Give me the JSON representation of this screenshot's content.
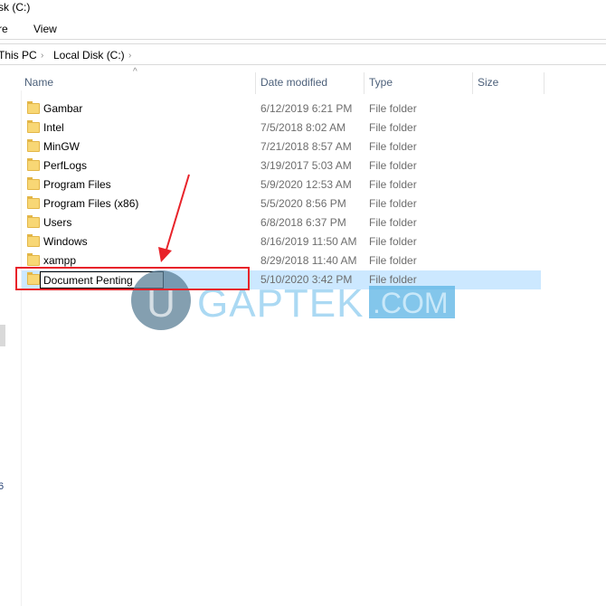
{
  "window": {
    "title": "sk (C:)"
  },
  "ribbon": {
    "tabs": [
      "re",
      "View"
    ]
  },
  "breadcrumb": [
    "This PC",
    "Local Disk (C:)"
  ],
  "columns": [
    "Name",
    "Date modified",
    "Type",
    "Size"
  ],
  "files": [
    {
      "name": "Gambar",
      "date": "6/12/2019 6:21 PM",
      "type": "File folder"
    },
    {
      "name": "Intel",
      "date": "7/5/2018 8:02 AM",
      "type": "File folder"
    },
    {
      "name": "MinGW",
      "date": "7/21/2018 8:57 AM",
      "type": "File folder"
    },
    {
      "name": "PerfLogs",
      "date": "3/19/2017 5:03 AM",
      "type": "File folder"
    },
    {
      "name": "Program Files",
      "date": "5/9/2020 12:53 AM",
      "type": "File folder"
    },
    {
      "name": "Program Files (x86)",
      "date": "5/5/2020 8:56 PM",
      "type": "File folder"
    },
    {
      "name": "Users",
      "date": "6/8/2018 6:37 PM",
      "type": "File folder"
    },
    {
      "name": "Windows",
      "date": "8/16/2019 11:50 AM",
      "type": "File folder"
    },
    {
      "name": "xampp",
      "date": "8/29/2018 11:40 AM",
      "type": "File folder"
    },
    {
      "name": "Document Penting",
      "date": "5/10/2020 3:42 PM",
      "type": "File folder"
    }
  ],
  "leftpane": {
    "fragment": "6"
  },
  "watermark": {
    "letter": "U",
    "brand": "GAPTEK",
    ".com": ".COM"
  },
  "colors": {
    "selection": "#cce8ff",
    "annotation": "#e8232a",
    "watermark": "#5ab4e5"
  }
}
